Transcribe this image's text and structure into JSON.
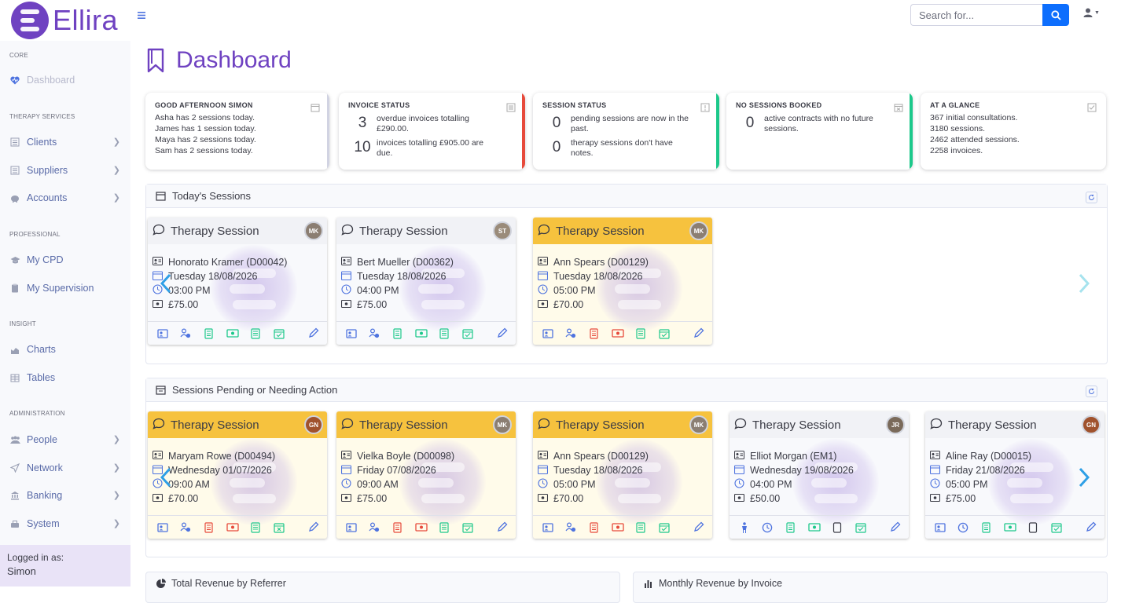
{
  "brand": {
    "name": "Ellira"
  },
  "search": {
    "placeholder": "Search for..."
  },
  "sidebar": {
    "sections": [
      {
        "heading": "CORE",
        "items": [
          {
            "label": "Dashboard",
            "icon": "heart-pulse-icon",
            "chevron": false,
            "active": true
          }
        ]
      },
      {
        "heading": "THERAPY SERVICES",
        "items": [
          {
            "label": "Clients",
            "icon": "clients-icon",
            "chevron": true
          },
          {
            "label": "Suppliers",
            "icon": "suppliers-icon",
            "chevron": true
          },
          {
            "label": "Accounts",
            "icon": "piggy-bank-icon",
            "chevron": true
          }
        ]
      },
      {
        "heading": "PROFESSIONAL",
        "items": [
          {
            "label": "My CPD",
            "icon": "graduation-cap-icon",
            "chevron": false
          },
          {
            "label": "My Supervision",
            "icon": "clipboard-icon",
            "chevron": false
          }
        ]
      },
      {
        "heading": "INSIGHT",
        "items": [
          {
            "label": "Charts",
            "icon": "area-chart-icon",
            "chevron": false
          },
          {
            "label": "Tables",
            "icon": "table-icon",
            "chevron": false
          }
        ]
      },
      {
        "heading": "ADMINISTRATION",
        "items": [
          {
            "label": "People",
            "icon": "people-icon",
            "chevron": true
          },
          {
            "label": "Network",
            "icon": "send-icon",
            "chevron": true
          },
          {
            "label": "Banking",
            "icon": "bank-icon",
            "chevron": true
          },
          {
            "label": "System",
            "icon": "system-icon",
            "chevron": true
          }
        ]
      }
    ],
    "logged_in_label": "Logged in as:",
    "logged_in_user": "Simon"
  },
  "page": {
    "title": "Dashboard"
  },
  "stats": {
    "greeting": {
      "title": "GOOD AFTERNOON SIMON",
      "lines": [
        "Asha has 2 sessions today.",
        "James has 1 session today.",
        "Maya has 2 sessions today.",
        "Sam has 2 sessions today."
      ]
    },
    "invoice": {
      "title": "INVOICE STATUS",
      "rows": [
        {
          "num": "3",
          "text": "overdue invoices totalling £290.00."
        },
        {
          "num": "10",
          "text": "invoices totalling £905.00 are due."
        }
      ],
      "accent": "#e74a3b"
    },
    "session": {
      "title": "SESSION STATUS",
      "rows": [
        {
          "num": "0",
          "text": "pending sessions are now in the past."
        },
        {
          "num": "0",
          "text": "therapy sessions don't have notes."
        }
      ],
      "accent": "#1cc88a"
    },
    "nosessions": {
      "title": "NO SESSIONS BOOKED",
      "rows": [
        {
          "num": "0",
          "text": "active contracts with no future sessions."
        }
      ],
      "accent": "#1cc88a"
    },
    "glance": {
      "title": "AT A GLANCE",
      "lines": [
        "367 initial consultations.",
        "3180 sessions.",
        "2462 attended sessions.",
        "2258 invoices."
      ]
    }
  },
  "today": {
    "title": "Today's Sessions",
    "cards": [
      {
        "title": "Therapy Session",
        "initials": "MK",
        "client": "Honorato Kramer (D00042)",
        "date": "Tuesday 18/08/2026",
        "time": "03:00 PM",
        "fee": "£75.00",
        "warn": false,
        "alerts": false
      },
      {
        "title": "Therapy Session",
        "initials": "ST",
        "client": "Bert Mueller (D00362)",
        "date": "Tuesday 18/08/2026",
        "time": "04:00 PM",
        "fee": "£75.00",
        "warn": false,
        "alerts": false
      },
      {
        "title": "Therapy Session",
        "initials": "MK",
        "client": "Ann Spears (D00129)",
        "date": "Tuesday 18/08/2026",
        "time": "05:00 PM",
        "fee": "£70.00",
        "warn": true,
        "alerts": true
      }
    ]
  },
  "pending": {
    "title": "Sessions Pending or Needing Action",
    "cards": [
      {
        "title": "Therapy Session",
        "initials": "GN",
        "client": "Maryam Rowe (D00494)",
        "date": "Wednesday 01/07/2026",
        "time": "09:00 AM",
        "fee": "£70.00",
        "warn": true,
        "alerts": true
      },
      {
        "title": "Therapy Session",
        "initials": "MK",
        "client": "Vielka Boyle (D00098)",
        "date": "Friday 07/08/2026",
        "time": "09:00 AM",
        "fee": "£75.00",
        "warn": true,
        "alerts": true
      },
      {
        "title": "Therapy Session",
        "initials": "MK",
        "client": "Ann Spears (D00129)",
        "date": "Tuesday 18/08/2026",
        "time": "05:00 PM",
        "fee": "£70.00",
        "warn": true,
        "alerts": true
      },
      {
        "title": "Therapy Session",
        "initials": "JR",
        "client": "Elliot Morgan (EM1)",
        "date": "Wednesday 19/08/2026",
        "time": "04:00 PM",
        "fee": "£50.00",
        "warn": false,
        "alerts": false
      },
      {
        "title": "Therapy Session",
        "initials": "GN",
        "client": "Aline Ray (D00015)",
        "date": "Friday 21/08/2026",
        "time": "05:00 PM",
        "fee": "£75.00",
        "warn": false,
        "alerts": false
      }
    ]
  },
  "bottom_panels": [
    {
      "title": "Total Revenue by Referrer"
    },
    {
      "title": "Monthly Revenue by Invoice"
    }
  ],
  "colors": {
    "brand": "#6f42c1",
    "primary": "#0d6efd",
    "danger": "#e74a3b",
    "success": "#1cc88a",
    "warning": "#f6c23e",
    "info": "#36b9cc"
  }
}
